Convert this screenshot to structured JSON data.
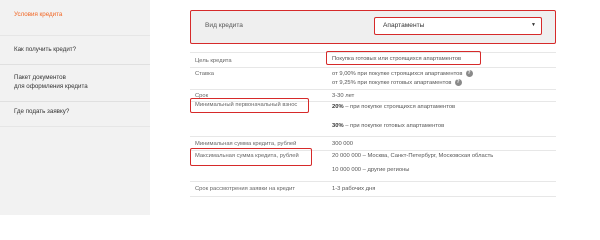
{
  "sidebar": {
    "items": [
      {
        "label": "Условия кредита",
        "active": true
      },
      {
        "label": "Как получить кредит?"
      },
      {
        "label_line1": "Пакет документов",
        "label_line2": "для оформления кредита"
      },
      {
        "label": "Где подать заявку?"
      }
    ]
  },
  "loan_kind": {
    "label": "Вид кредита",
    "selected": "Апартаменты"
  },
  "rows": {
    "purpose": {
      "label": "Цель кредита",
      "value": "Покупка готовых или строящихся апартаментов"
    },
    "rate": {
      "label": "Ставка",
      "line1": "от 9,00% при покупке строящихся апартаментов",
      "line2": "от 9,25% при покупке готовых апартаментов"
    },
    "term": {
      "label": "Срок",
      "value": "3-30 лет"
    },
    "down_payment": {
      "label": "Минимальный первоначальный взнос",
      "line1_bold": "20%",
      "line1_rest": " – при покупке строящихся апартаментов",
      "line2_bold": "30%",
      "line2_rest": " – при покупке готовых апартаментов"
    },
    "min_amount": {
      "label": "Минимальная сумма кредита, рублей",
      "value": "300 000"
    },
    "max_amount": {
      "label": "Максимальная сумма кредита, рублей",
      "line1": "20 000 000 – Москва, Санкт-Петербург, Московская область",
      "line2": "10 000 000 – другие регионы"
    },
    "review": {
      "label": "Срок рассмотрения заявки на кредит",
      "value": "1-3 рабочих дня"
    }
  },
  "icons": {
    "help": "?",
    "dropdown": "▼"
  },
  "colors": {
    "accent": "#f26522",
    "highlight": "#d62a2a"
  }
}
